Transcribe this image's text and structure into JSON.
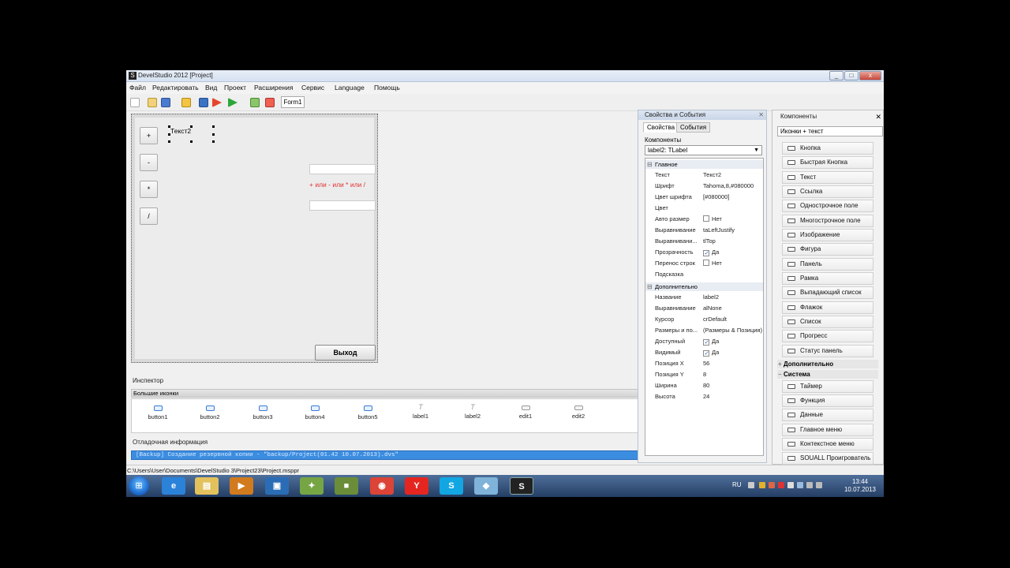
{
  "window": {
    "title": "DevelStudio 2012 [Project]",
    "app_icon": "S",
    "min": "_",
    "max": "□",
    "close": "x"
  },
  "menu": [
    "Файл",
    "Редактировать",
    "Вид",
    "Проект",
    "Расширения",
    "Сервис",
    "Language",
    "Помощь"
  ],
  "toolbar": {
    "form_tab": "Form1"
  },
  "form": {
    "buttons": [
      "+",
      "-",
      "*",
      "/"
    ],
    "label_text": "Текст2",
    "hint_text": "+ или - или * или /",
    "exit_label": "Выход"
  },
  "inspector": {
    "title": "Инспектор",
    "view_mode": "Большие иконки",
    "items": [
      {
        "name": "button1",
        "icon": "button-icon"
      },
      {
        "name": "button2",
        "icon": "button-icon"
      },
      {
        "name": "button3",
        "icon": "button-icon"
      },
      {
        "name": "button4",
        "icon": "button-icon"
      },
      {
        "name": "button5",
        "icon": "button-icon"
      },
      {
        "name": "label1",
        "icon": "text-icon"
      },
      {
        "name": "label2",
        "icon": "text-icon"
      },
      {
        "name": "edit1",
        "icon": "edit-icon"
      },
      {
        "name": "edit2",
        "icon": "edit-icon"
      }
    ]
  },
  "debug": {
    "title": "Отладочная информация",
    "line": "[Backup] Создание резервной копии - \"backup/Project(01.42 10.07.2013).dvs\""
  },
  "status": {
    "path": "C:\\Users\\User\\Documents\\DevelStudio 3\\Project23\\Project.msppr"
  },
  "properties": {
    "title": "Свойства и События",
    "tabs": [
      "Свойства",
      "События"
    ],
    "components_label": "Компоненты",
    "selected_component": "label2: TLabel",
    "sections": {
      "main": "Главное",
      "extra": "Дополнительно"
    },
    "main_rows": [
      {
        "key": "Текст",
        "value": "Текст2"
      },
      {
        "key": "Шрифт",
        "value": "Tahoma,8,#080000"
      },
      {
        "key": "Цвет шрифта",
        "value": "[#080000]"
      },
      {
        "key": "Цвет",
        "value": ""
      },
      {
        "key": "Авто размер",
        "value": "Нет",
        "checkbox": true,
        "checked": false
      },
      {
        "key": "Выравнивание",
        "value": "taLeftJustify"
      },
      {
        "key": "Выравнивани...",
        "value": "tlTop"
      },
      {
        "key": "Прозрачность",
        "value": "Да",
        "checkbox": true,
        "checked": true
      },
      {
        "key": "Перенос строк",
        "value": "Нет",
        "checkbox": true,
        "checked": false
      },
      {
        "key": "Подсказка",
        "value": ""
      }
    ],
    "extra_rows": [
      {
        "key": "Название",
        "value": "label2"
      },
      {
        "key": "Выравнивание",
        "value": "alNone"
      },
      {
        "key": "Курсор",
        "value": "crDefault"
      },
      {
        "key": "Размеры и по...",
        "value": "(Размеры & Позиция)"
      },
      {
        "key": "Доступный",
        "value": "Да",
        "checkbox": true,
        "checked": true
      },
      {
        "key": "Видимый",
        "value": "Да",
        "checkbox": true,
        "checked": true
      },
      {
        "key": "Позиция X",
        "value": "56"
      },
      {
        "key": "Позиция Y",
        "value": "8"
      },
      {
        "key": "Ширина",
        "value": "80"
      },
      {
        "key": "Высота",
        "value": "24"
      }
    ]
  },
  "components": {
    "title": "Компоненты",
    "filter": "Иконки + текст",
    "items": [
      "Кнопка",
      "Быстрая Кнопка",
      "Текст",
      "Ссылка",
      "Однострочное поле",
      "Многострочное поле",
      "Изображение",
      "Фигура",
      "Панель",
      "Рамка",
      "Выпадающий список",
      "Флажок",
      "Список",
      "Прогресс",
      "Статус панель"
    ],
    "section_extra": "Дополнительно",
    "section_system": "Система",
    "system_items": [
      "Таймер",
      "Функция",
      "Данные",
      "Главное меню",
      "Контекстное меню",
      "SOUALL Проигрователь"
    ]
  },
  "taskbar": {
    "lang": "RU",
    "time": "13:44",
    "date": "10.07.2013"
  }
}
